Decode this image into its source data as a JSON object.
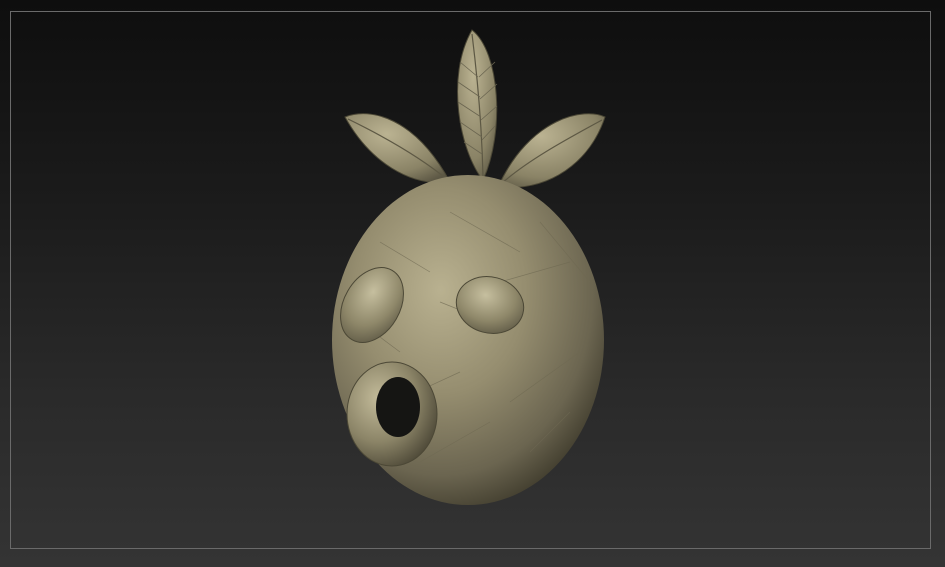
{
  "viewport": {
    "background_top": "#0e0e0e",
    "background_bottom": "#343434",
    "frame_color": "#6a6a6a"
  },
  "model": {
    "type": "sculpted-mask",
    "material_color": "#8c8466",
    "highlight_color": "#bdb596",
    "shadow_color": "#3f3b2c",
    "features": [
      "leaves",
      "eyes",
      "mouth-ring"
    ]
  }
}
